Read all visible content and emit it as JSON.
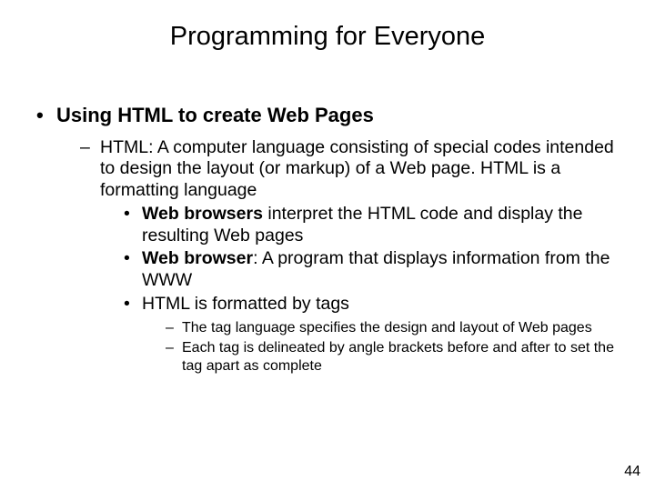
{
  "title": "Programming for Everyone",
  "lvl1": {
    "heading": "Using HTML to create Web Pages",
    "lvl2": {
      "def": "HTML: A computer language consisting of special codes intended to design the layout (or markup) of a Web page. HTML is a formatting language",
      "lvl3": {
        "a_bold": "Web browsers",
        "a_rest": " interpret the HTML code and display the resulting Web pages",
        "b_bold": "Web browser",
        "b_rest": ": A program that displays information from the WWW",
        "c": "HTML is formatted by tags",
        "lvl4": {
          "a": "The tag language specifies the design and layout of Web pages",
          "b": "Each tag is delineated by angle brackets before and after to set the tag apart as complete"
        }
      }
    }
  },
  "page_number": "44"
}
